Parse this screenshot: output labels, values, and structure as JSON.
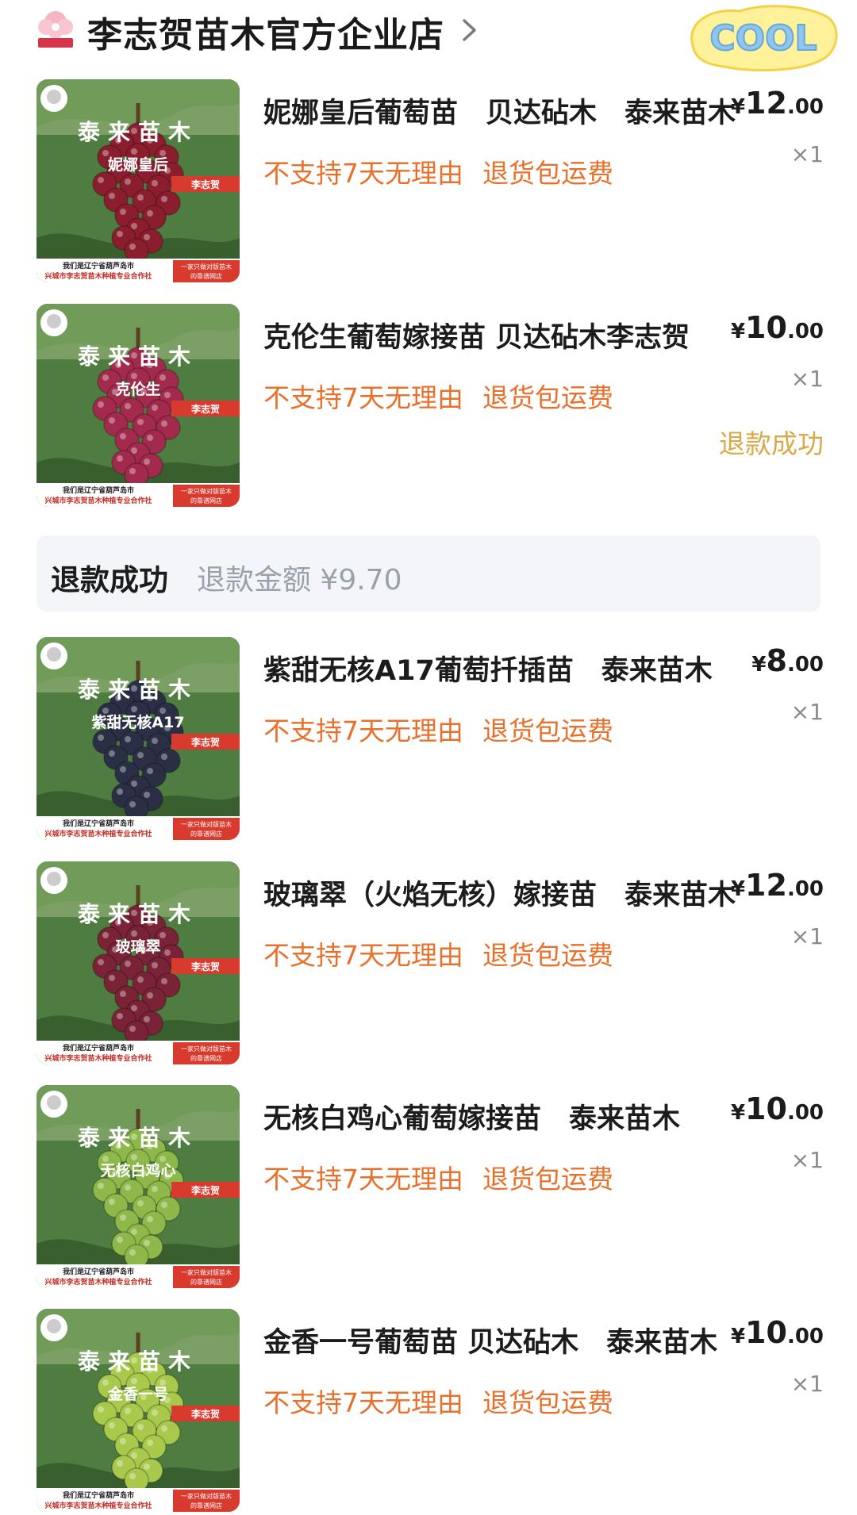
{
  "shop": {
    "name": "李志贺苗木官方企业店",
    "badge_text": "COOL"
  },
  "thumb_text": {
    "brand": "泰来苗木",
    "seller_tag": "李志贺",
    "footer_left_1": "我们是辽宁省葫芦岛市",
    "footer_left_2": "兴城市李志贺苗木种植专业合作社",
    "footer_right_1": "一家只做对版苗木",
    "footer_right_2": "的靠谱网店"
  },
  "tags": {
    "no_return": "不支持7天无理由",
    "shipping": "退货包运费"
  },
  "items": [
    {
      "title": "妮娜皇后葡萄苗　贝达砧木　泰来苗木",
      "price_symbol": "¥",
      "price_int": "12",
      "price_dec": ".00",
      "qty": "×1",
      "variety": "妮娜皇后",
      "grape_color": "#8b1e2e",
      "status": ""
    },
    {
      "title": "克伦生葡萄嫁接苗 贝达砧木李志贺",
      "price_symbol": "¥",
      "price_int": "10",
      "price_dec": ".00",
      "qty": "×1",
      "variety": "克伦生",
      "grape_color": "#a22a4d",
      "status": "退款成功"
    },
    {
      "title": "紫甜无核A17葡萄扦插苗　泰来苗木",
      "price_symbol": "¥",
      "price_int": "8",
      "price_dec": ".00",
      "qty": "×1",
      "variety": "紫甜无核A17",
      "grape_color": "#2a2f45",
      "status": ""
    },
    {
      "title": "玻璃翠（火焰无核）嫁接苗　泰来苗木",
      "price_symbol": "¥",
      "price_int": "12",
      "price_dec": ".00",
      "qty": "×1",
      "variety": "玻璃翠",
      "grape_color": "#7a2236",
      "status": ""
    },
    {
      "title": "无核白鸡心葡萄嫁接苗　泰来苗木",
      "price_symbol": "¥",
      "price_int": "10",
      "price_dec": ".00",
      "qty": "×1",
      "variety": "无核白鸡心",
      "grape_color": "#8fb84a",
      "status": ""
    },
    {
      "title": "金香一号葡萄苗 贝达砧木　泰来苗木",
      "price_symbol": "¥",
      "price_int": "10",
      "price_dec": ".00",
      "qty": "×1",
      "variety": "金香一号",
      "grape_color": "#a9c94d",
      "status": ""
    }
  ],
  "refund_summary": {
    "label": "退款成功",
    "amount_text": "退款金额 ¥9.70"
  },
  "colors": {
    "tag_orange": "#e9702b",
    "refund_gold": "#d9a94a",
    "refund_bar_bg": "#f3f5f8"
  }
}
